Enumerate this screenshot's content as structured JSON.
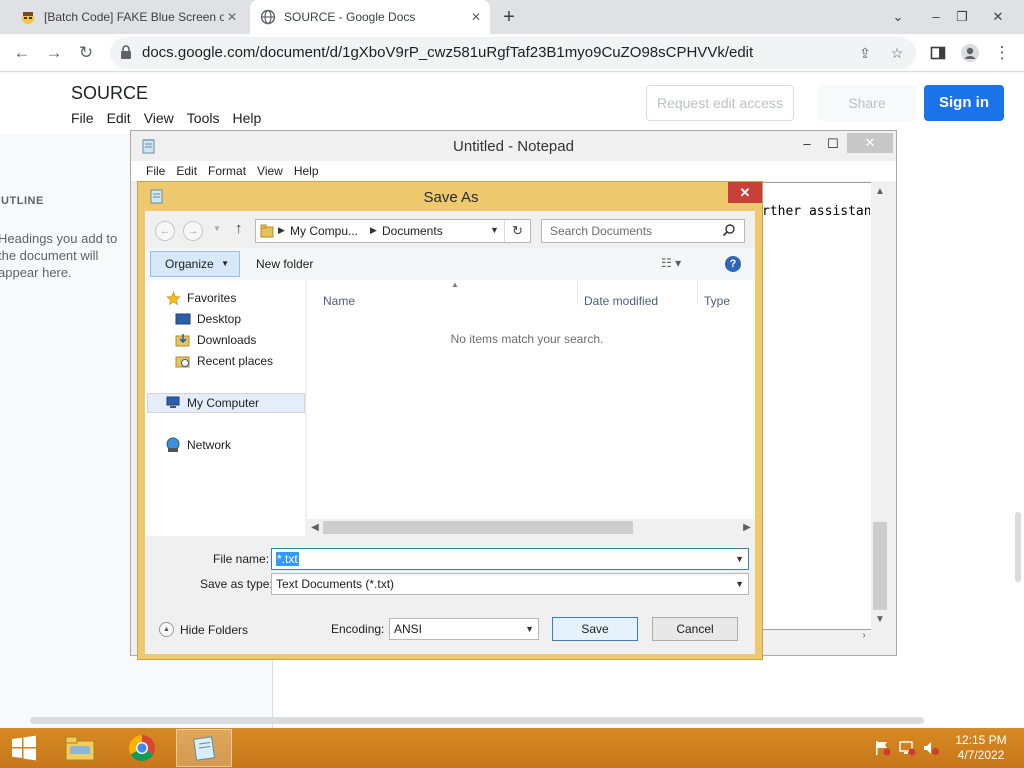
{
  "browser": {
    "tabs": [
      {
        "title": "[Batch Code] FAKE Blue Screen of",
        "icon": "hacker-emoji-icon",
        "active": false
      },
      {
        "title": "SOURCE - Google Docs",
        "icon": "globe-icon",
        "active": true
      }
    ],
    "url": "docs.google.com/document/d/1gXboV9rP_cwz581uRgfTaf23B1myo9CuZO98sCPHVVk/edit"
  },
  "docs": {
    "title": "SOURCE",
    "menu": [
      "File",
      "Edit",
      "View",
      "Tools",
      "Help"
    ],
    "request_edit_label": "Request edit access",
    "share_label": "Share",
    "sign_in_label": "Sign in",
    "outline_title": "OUTLINE",
    "outline_hint": "Headings you add to the document will appear here.",
    "accent_color": "#1a73e8"
  },
  "notepad": {
    "title": "Untitled - Notepad",
    "menu": [
      "File",
      "Edit",
      "Format",
      "View",
      "Help"
    ],
    "visible_text": "rther assistan"
  },
  "save_as": {
    "title": "Save As",
    "breadcrumb": [
      "My Compu...",
      "Documents"
    ],
    "search_placeholder": "Search Documents",
    "organize_label": "Organize",
    "new_folder_label": "New folder",
    "tree": {
      "favorites": "Favorites",
      "desktop": "Desktop",
      "downloads": "Downloads",
      "recent": "Recent places",
      "my_computer": "My Computer",
      "network": "Network"
    },
    "columns": [
      "Name",
      "Date modified",
      "Type"
    ],
    "empty_message": "No items match your search.",
    "file_name_label": "File name:",
    "file_name_value": "*.txt",
    "save_type_label": "Save as type:",
    "save_type_value": "Text Documents (*.txt)",
    "encoding_label": "Encoding:",
    "encoding_value": "ANSI",
    "save_label": "Save",
    "cancel_label": "Cancel",
    "hide_folders_label": "Hide Folders",
    "frame_color": "#eec96e",
    "close_color": "#c7413a"
  },
  "taskbar": {
    "time": "12:15 PM",
    "date": "4/7/2022",
    "color": "#d68a22"
  }
}
